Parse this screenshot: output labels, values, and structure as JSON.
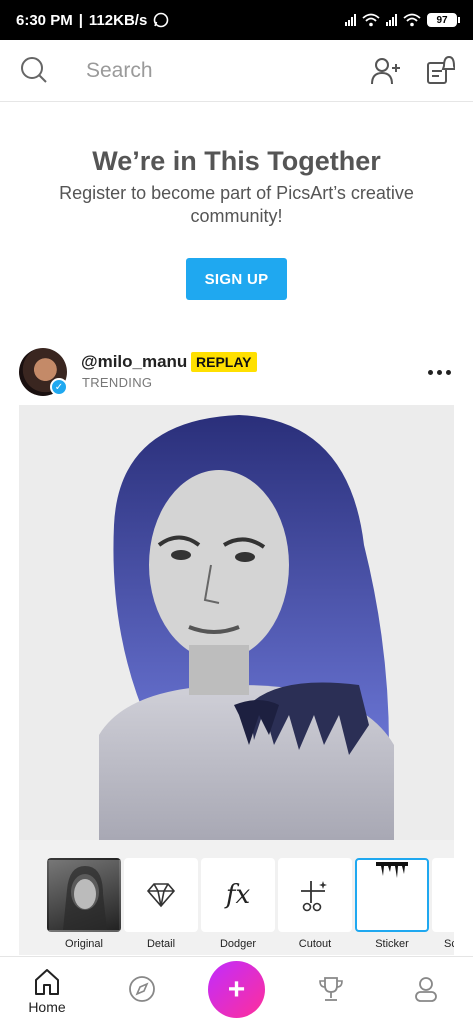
{
  "status": {
    "time": "6:30 PM",
    "speed": "112KB/s",
    "battery": "97"
  },
  "search": {
    "placeholder": "Search"
  },
  "promo": {
    "title": "We’re in This Together",
    "subtitle": "Register to become part of PicsArt’s creative community!",
    "signup_label": "SIGN UP"
  },
  "post": {
    "username": "@milo_manu",
    "badge": "REPLAY",
    "tag": "TRENDING"
  },
  "effects": [
    {
      "label": "Original"
    },
    {
      "label": "Detail"
    },
    {
      "label": "Dodger"
    },
    {
      "label": "Cutout"
    },
    {
      "label": "Sticker"
    },
    {
      "label": "Sc"
    }
  ],
  "nav": {
    "home": "Home"
  },
  "colors": {
    "accent": "#1fa8f0",
    "badge": "#ffe000"
  }
}
